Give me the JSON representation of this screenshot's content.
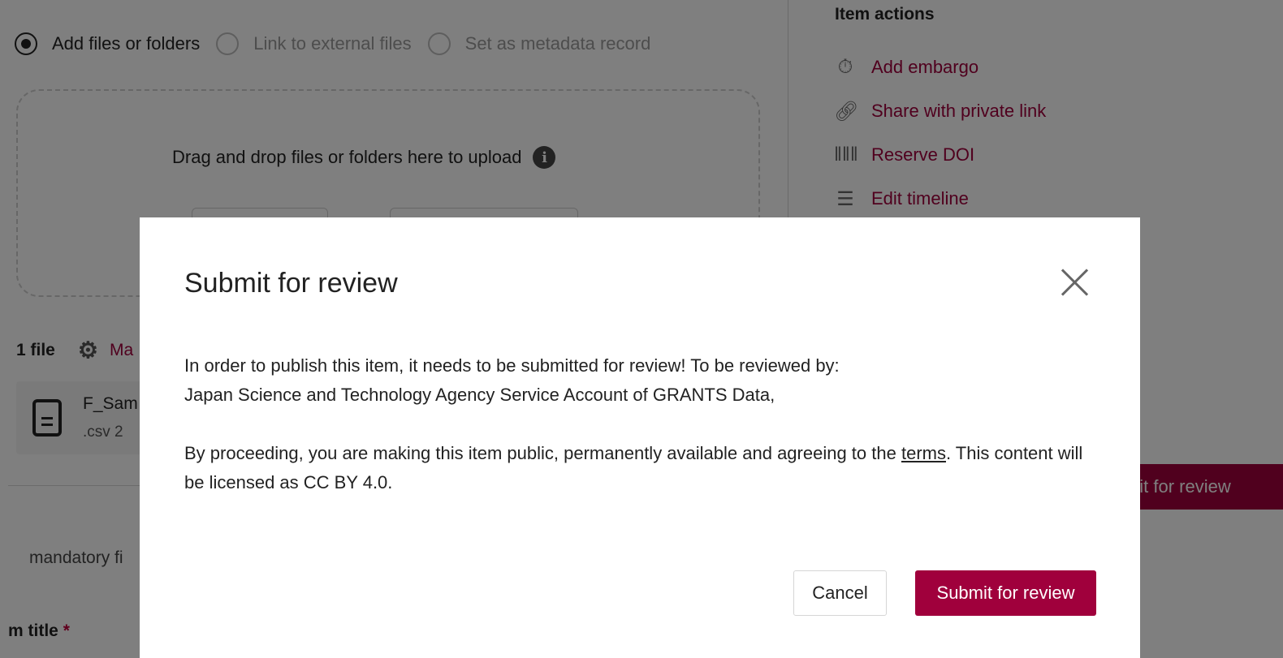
{
  "upload": {
    "options": [
      "Add files or folders",
      "Link to external files",
      "Set as metadata record"
    ],
    "dropzone_text": "Drag and drop files or folders here to upload",
    "file_count": "1 file",
    "manage_label": "Ma",
    "file": {
      "name": "F_Sam",
      "meta": ".csv  2"
    }
  },
  "form": {
    "mandatory_note": "mandatory fi",
    "title_label": "m title",
    "required_mark": "*"
  },
  "sidebar": {
    "heading": "Item actions",
    "actions": [
      {
        "label": "Add embargo",
        "icon": "stopwatch-icon"
      },
      {
        "label": "Share with private link",
        "icon": "link-icon"
      },
      {
        "label": "Reserve DOI",
        "icon": "barcode-icon"
      },
      {
        "label": "Edit timeline",
        "icon": "list-icon"
      }
    ],
    "submit_partial": "nit for review"
  },
  "modal": {
    "title": "Submit for review",
    "para1_line1": "In order to publish this item, it needs to be submitted for review! To be reviewed by:",
    "para1_line2": "Japan Science and Technology Agency Service Account of GRANTS Data,",
    "para2_before": "By proceeding, you are making this item public, permanently available and agreeing to the ",
    "para2_link": "terms",
    "para2_after": ". This content will be licensed as CC BY 4.0.",
    "cancel_label": "Cancel",
    "submit_label": "Submit for review"
  },
  "colors": {
    "accent": "#a0003c",
    "overlay": "rgba(0,0,0,0.5)"
  }
}
